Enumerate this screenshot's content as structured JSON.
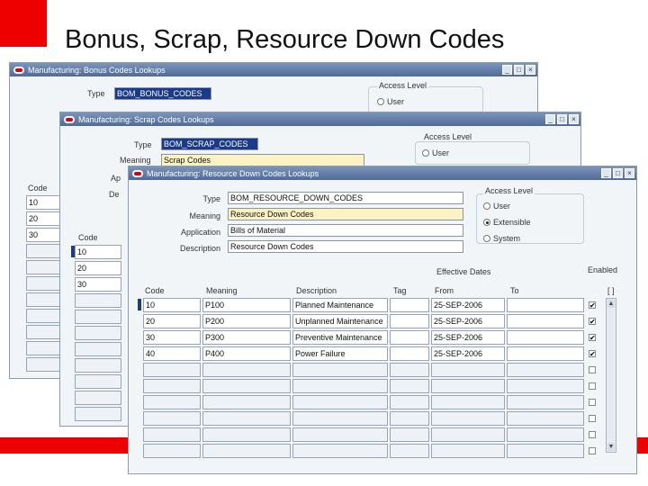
{
  "slide": {
    "title": "Bonus, Scrap, Resource Down Codes"
  },
  "win1": {
    "title": "Manufacturing: Bonus Codes Lookups",
    "type_label": "Type",
    "type_value": "BOM_BONUS_CODES",
    "access_label": "Access Level",
    "access_user": "User",
    "code_header": "Code",
    "codes": [
      "10",
      "20",
      "30"
    ]
  },
  "win2": {
    "title": "Manufacturing: Scrap Codes Lookups",
    "type_label": "Type",
    "type_value": "BOM_SCRAP_CODES",
    "meaning_label": "Meaning",
    "meaning_value": "Scrap Codes",
    "app_label": "Ap",
    "desc_label": "De",
    "access_label": "Access Level",
    "access_user": "User",
    "code_header": "Code",
    "codes": [
      "10",
      "20",
      "30"
    ]
  },
  "win3": {
    "title": "Manufacturing: Resource Down Codes Lookups",
    "type_label": "Type",
    "type_value": "BOM_RESOURCE_DOWN_CODES",
    "meaning_label": "Meaning",
    "meaning_value": "Resource Down Codes",
    "application_label": "Application",
    "application_value": "Bills of Material",
    "description_label": "Description",
    "description_value": "Resource Down Codes",
    "access_label": "Access Level",
    "access_user": "User",
    "access_extensible": "Extensible",
    "access_system": "System",
    "effective_dates": "Effective Dates",
    "enabled": "Enabled",
    "bracket": "[ ]",
    "columns": {
      "code": "Code",
      "meaning": "Meaning",
      "description": "Description",
      "tag": "Tag",
      "from": "From",
      "to": "To"
    },
    "rows": [
      {
        "code": "10",
        "meaning": "P100",
        "description": "Planned Maintenance",
        "tag": "",
        "from": "25-SEP-2006",
        "to": "",
        "enabled": true
      },
      {
        "code": "20",
        "meaning": "P200",
        "description": "Unplanned Maintenance",
        "tag": "",
        "from": "25-SEP-2006",
        "to": "",
        "enabled": true
      },
      {
        "code": "30",
        "meaning": "P300",
        "description": "Preventive Maintenance",
        "tag": "",
        "from": "25-SEP-2006",
        "to": "",
        "enabled": true
      },
      {
        "code": "40",
        "meaning": "P400",
        "description": "Power Failure",
        "tag": "",
        "from": "25-SEP-2006",
        "to": "",
        "enabled": true
      }
    ]
  }
}
